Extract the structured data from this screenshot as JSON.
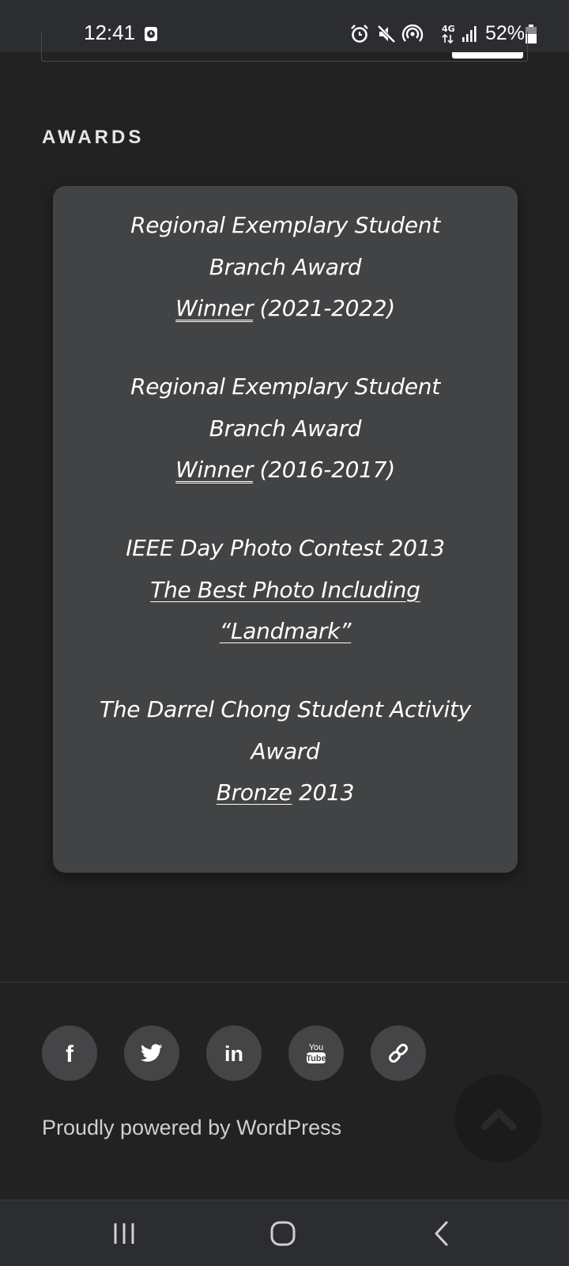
{
  "status_bar": {
    "time": "12:41",
    "battery": "52%",
    "icons": [
      "clock-notification-icon",
      "alarm-icon",
      "mute-icon",
      "hotspot-icon",
      "4g-icon",
      "signal-icon",
      "battery-icon"
    ]
  },
  "section": {
    "title": "AWARDS"
  },
  "awards": [
    {
      "line1": "Regional Exemplary Student",
      "line2": "Branch Award",
      "link": "Winner",
      "suffix": " (2021-2022)"
    },
    {
      "line1": "Regional Exemplary Student",
      "line2": "Branch Award",
      "link": "Winner",
      "suffix": " (2016-2017)"
    },
    {
      "line1": "IEEE Day Photo Contest 2013",
      "line2": "The Best Photo Including",
      "line3": "“Landmark”"
    },
    {
      "line1": "The Darrel Chong Student Activity",
      "line2": "Award",
      "link": "Bronze",
      "suffix": " 2013"
    }
  ],
  "footer": {
    "social": [
      {
        "name": "facebook-icon",
        "label": "f"
      },
      {
        "name": "twitter-icon",
        "label": "twitter"
      },
      {
        "name": "linkedin-icon",
        "label": "in"
      },
      {
        "name": "youtube-icon",
        "label_top": "You",
        "label_bottom": "Tube"
      },
      {
        "name": "link-icon",
        "label": "link"
      }
    ],
    "powered_by": "Proudly powered by WordPress"
  },
  "colors": {
    "background": "#222223",
    "card": "#424345",
    "text": "#ffffff",
    "social_bg": "#454547",
    "system_bar": "#2c2d31"
  }
}
